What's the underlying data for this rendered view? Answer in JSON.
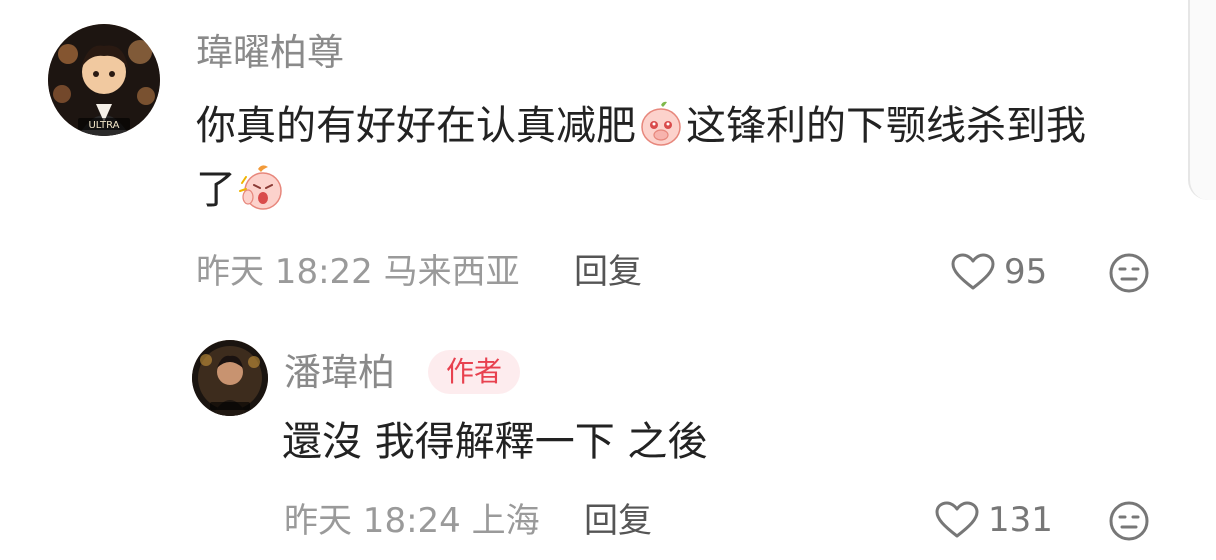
{
  "comments": [
    {
      "username": "瑋曜柏尊",
      "avatar_text": "ULTRA",
      "content_line1_a": "你真的有好好在认真减肥",
      "emoji1": "crying-peach-emoji",
      "content_line1_b": "这锋利的下颚线杀到我",
      "content_line2": "了",
      "emoji2": "shocked-peach-emoji",
      "meta": "昨天 18:22 马来西亚",
      "reply_label": "回复",
      "likes": "95"
    },
    {
      "username": "潘瑋柏",
      "badge": "作者",
      "content": "還沒 我得解釋一下 之後",
      "meta": "昨天 18:24 上海",
      "reply_label": "回复",
      "likes": "131"
    }
  ],
  "icons": {
    "like": "heart-outline-icon",
    "dislike": "meh-face-icon"
  },
  "colors": {
    "text_primary": "#222222",
    "text_secondary": "#8a8a8a",
    "badge_bg": "#fdecee",
    "badge_text": "#e8414f"
  }
}
